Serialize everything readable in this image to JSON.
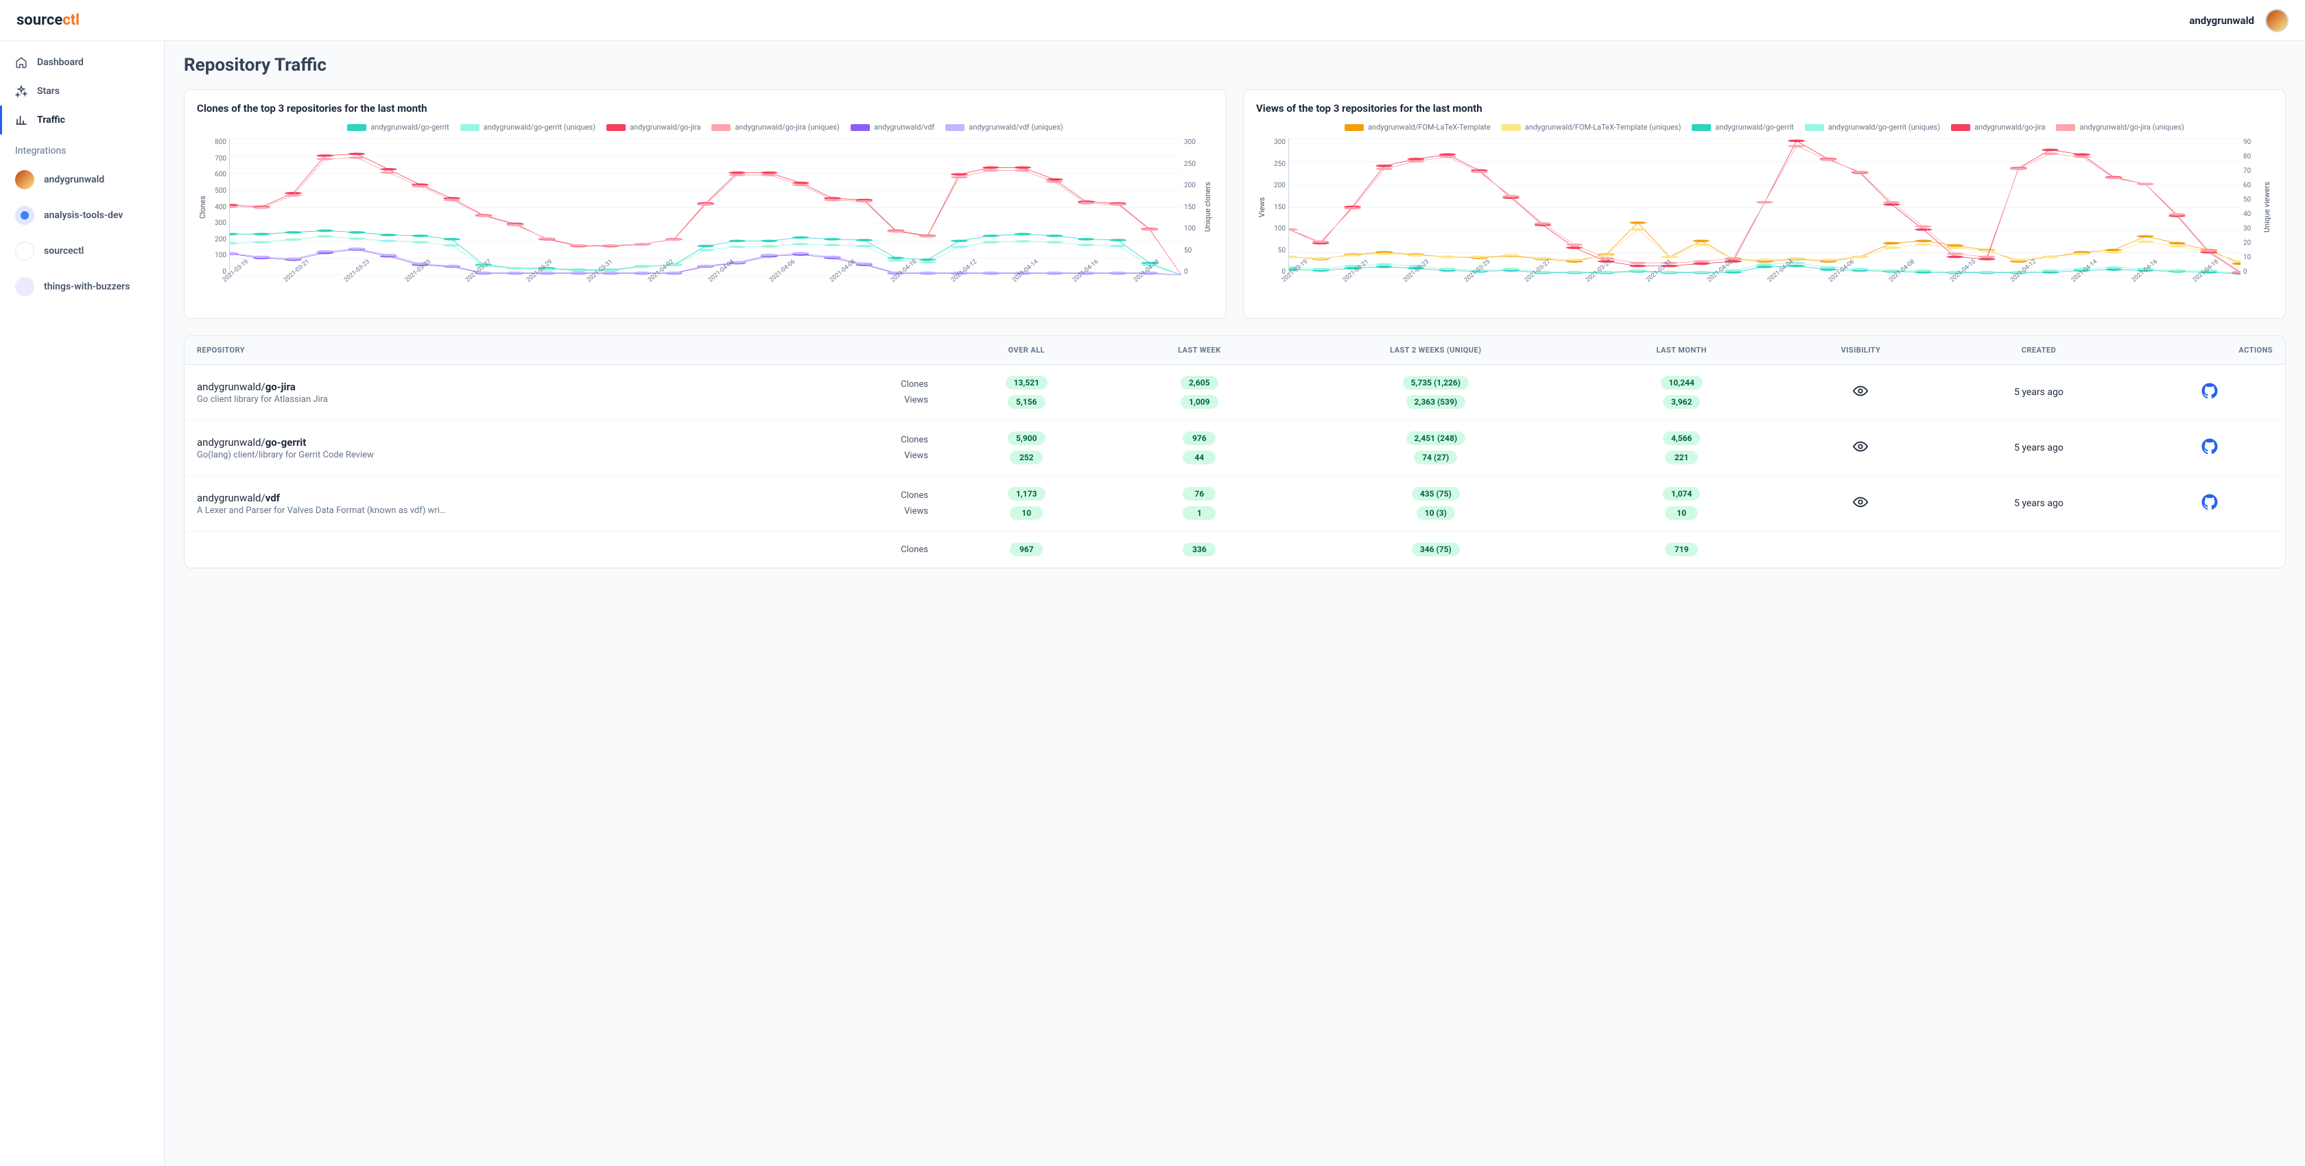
{
  "brand": {
    "p1": "source",
    "p2": "ctl"
  },
  "user": {
    "name": "andygrunwald"
  },
  "nav": [
    {
      "icon": "home",
      "label": "Dashboard",
      "active": false
    },
    {
      "icon": "sparkle",
      "label": "Stars",
      "active": false
    },
    {
      "icon": "chart",
      "label": "Traffic",
      "active": true
    }
  ],
  "sidebar_section": "Integrations",
  "integrations": [
    {
      "kind": "user",
      "label": "andygrunwald"
    },
    {
      "kind": "gear",
      "label": "analysis-tools-dev"
    },
    {
      "kind": "source",
      "label": "sourcectl"
    },
    {
      "kind": "buzz",
      "label": "things-with-buzzers"
    }
  ],
  "page_title": "Repository Traffic",
  "clones_chart_title": "Clones of the top 3 repositories for the last month",
  "views_chart_title": "Views of the top 3 repositories for the last month",
  "table": {
    "headers": {
      "repo": "REPOSITORY",
      "overall": "OVER ALL",
      "lastweek": "LAST WEEK",
      "last2": "LAST 2 WEEKS (UNIQUE)",
      "lastmonth": "LAST MONTH",
      "visibility": "VISIBILITY",
      "created": "CREATED",
      "actions": "ACTIONS"
    },
    "row_labels": {
      "clones": "Clones",
      "views": "Views"
    },
    "rows": [
      {
        "owner": "andygrunwald/",
        "name": "go-jira",
        "desc": "Go client library for Atlassian Jira",
        "clones": {
          "overall": "13,521",
          "lastweek": "2,605",
          "last2": "5,735 (1,226)",
          "lastmonth": "10,244"
        },
        "views": {
          "overall": "5,156",
          "lastweek": "1,009",
          "last2": "2,363 (539)",
          "lastmonth": "3,962"
        },
        "created": "5 years ago"
      },
      {
        "owner": "andygrunwald/",
        "name": "go-gerrit",
        "desc": "Go(lang) client/library for Gerrit Code Review",
        "clones": {
          "overall": "5,900",
          "lastweek": "976",
          "last2": "2,451 (248)",
          "lastmonth": "4,566"
        },
        "views": {
          "overall": "252",
          "lastweek": "44",
          "last2": "74 (27)",
          "lastmonth": "221"
        },
        "created": "5 years ago"
      },
      {
        "owner": "andygrunwald/",
        "name": "vdf",
        "desc": "A Lexer and Parser for Valves Data Format (known as vdf) wri…",
        "clones": {
          "overall": "1,173",
          "lastweek": "76",
          "last2": "435 (75)",
          "lastmonth": "1,074"
        },
        "views": {
          "overall": "10",
          "lastweek": "1",
          "last2": "10 (3)",
          "lastmonth": "10"
        },
        "created": "5 years ago"
      },
      {
        "owner": "",
        "name": "",
        "desc": "",
        "clones": {
          "overall": "967",
          "lastweek": "336",
          "last2": "346 (75)",
          "lastmonth": "719"
        },
        "views": {
          "overall": "",
          "lastweek": "",
          "last2": "",
          "lastmonth": ""
        },
        "created": ""
      }
    ]
  },
  "chart_data": [
    {
      "id": "clones",
      "type": "line",
      "xlabel": "",
      "ylabel": "Clones",
      "y2label": "Unique cloners",
      "ylim": [
        0,
        800
      ],
      "y2lim": [
        0,
        300
      ],
      "yticks": [
        0,
        100,
        200,
        300,
        400,
        500,
        600,
        700,
        800
      ],
      "y2ticks": [
        0,
        50,
        100,
        150,
        200,
        250,
        300
      ],
      "categories": [
        "2021-03-19",
        "2021-03-21",
        "2021-03-23",
        "2021-03-25",
        "2021-03-27",
        "2021-03-29",
        "2021-03-31",
        "2021-04-02",
        "2021-04-04",
        "2021-04-06",
        "2021-04-08",
        "2021-04-10",
        "2021-04-12",
        "2021-04-14",
        "2021-04-16",
        "2021-04-18"
      ],
      "x": [
        0,
        1,
        2,
        3,
        4,
        5,
        6,
        7,
        8,
        9,
        10,
        11,
        12,
        13,
        14,
        15,
        16,
        17,
        18,
        19,
        20,
        21,
        22,
        23,
        24,
        25,
        26,
        27,
        28,
        29,
        30
      ],
      "series": [
        {
          "name": "andygrunwald/go-gerrit",
          "color": "#2dd4bf",
          "axis": "y",
          "values": [
            240,
            240,
            250,
            260,
            250,
            235,
            230,
            210,
            60,
            40,
            40,
            30,
            30,
            50,
            60,
            170,
            200,
            200,
            220,
            210,
            205,
            100,
            90,
            200,
            230,
            240,
            230,
            210,
            205,
            70,
            0
          ]
        },
        {
          "name": "andygrunwald/go-gerrit (uniques)",
          "color": "#99f6e4",
          "axis": "y2",
          "values": [
            70,
            72,
            78,
            85,
            80,
            75,
            72,
            65,
            20,
            15,
            12,
            10,
            10,
            18,
            22,
            55,
            62,
            63,
            68,
            66,
            64,
            32,
            28,
            62,
            72,
            74,
            72,
            66,
            64,
            22,
            0
          ]
        },
        {
          "name": "andygrunwald/go-jira",
          "color": "#f43f5e",
          "axis": "y",
          "values": [
            410,
            400,
            480,
            700,
            710,
            620,
            530,
            450,
            350,
            300,
            210,
            170,
            170,
            180,
            210,
            420,
            600,
            600,
            540,
            450,
            440,
            260,
            230,
            590,
            630,
            630,
            560,
            430,
            420,
            270,
            0
          ]
        },
        {
          "name": "andygrunwald/go-jira (uniques)",
          "color": "#fda4af",
          "axis": "y2",
          "values": [
            150,
            148,
            175,
            255,
            258,
            225,
            195,
            165,
            130,
            110,
            80,
            65,
            65,
            68,
            78,
            155,
            220,
            220,
            198,
            165,
            162,
            96,
            85,
            215,
            230,
            230,
            205,
            158,
            155,
            100,
            0
          ]
        },
        {
          "name": "andygrunwald/vdf",
          "color": "#8b5cf6",
          "axis": "y",
          "values": [
            125,
            100,
            90,
            130,
            150,
            110,
            60,
            50,
            10,
            10,
            10,
            10,
            10,
            10,
            10,
            50,
            70,
            110,
            120,
            100,
            60,
            10,
            10,
            10,
            10,
            10,
            10,
            10,
            10,
            10,
            0
          ]
        },
        {
          "name": "andygrunwald/vdf (uniques)",
          "color": "#c4b5fd",
          "axis": "y2",
          "values": [
            48,
            40,
            36,
            52,
            58,
            44,
            25,
            20,
            5,
            5,
            5,
            5,
            5,
            5,
            5,
            20,
            28,
            44,
            48,
            40,
            25,
            5,
            5,
            5,
            5,
            5,
            5,
            5,
            5,
            5,
            0
          ]
        }
      ]
    },
    {
      "id": "views",
      "type": "line",
      "xlabel": "",
      "ylabel": "Views",
      "y2label": "Unique viewers",
      "ylim": [
        0,
        300
      ],
      "y2lim": [
        0,
        90
      ],
      "yticks": [
        0,
        50,
        100,
        150,
        200,
        250,
        300
      ],
      "y2ticks": [
        0,
        10,
        20,
        30,
        40,
        50,
        60,
        70,
        80,
        90
      ],
      "categories": [
        "2021-03-19",
        "2021-03-21",
        "2021-03-23",
        "2021-03-25",
        "2021-03-27",
        "2021-03-29",
        "2021-03-31",
        "2021-04-02",
        "2021-04-04",
        "2021-04-06",
        "2021-04-08",
        "2021-04-10",
        "2021-04-12",
        "2021-04-14",
        "2021-04-16",
        "2021-04-18"
      ],
      "x": [
        0,
        1,
        2,
        3,
        4,
        5,
        6,
        7,
        8,
        9,
        10,
        11,
        12,
        13,
        14,
        15,
        16,
        17,
        18,
        19,
        20,
        21,
        22,
        23,
        24,
        25,
        26,
        27,
        28,
        29,
        30
      ],
      "series": [
        {
          "name": "andygrunwald/FOM-LaTeX-Template",
          "color": "#f59e0b",
          "axis": "y",
          "values": [
            40,
            35,
            45,
            50,
            45,
            40,
            38,
            42,
            35,
            30,
            45,
            115,
            40,
            75,
            35,
            30,
            35,
            30,
            40,
            70,
            75,
            65,
            55,
            30,
            40,
            50,
            55,
            85,
            70,
            55,
            25
          ]
        },
        {
          "name": "andygrunwald/FOM-LaTeX-Template (uniques)",
          "color": "#fde68a",
          "axis": "y2",
          "values": [
            12,
            11,
            13,
            14,
            13,
            12,
            12,
            13,
            11,
            10,
            13,
            30,
            12,
            20,
            11,
            10,
            11,
            10,
            12,
            18,
            20,
            18,
            16,
            10,
            12,
            14,
            15,
            22,
            19,
            15,
            9
          ]
        },
        {
          "name": "andygrunwald/go-gerrit",
          "color": "#2dd4bf",
          "axis": "y",
          "values": [
            12,
            10,
            15,
            18,
            15,
            10,
            8,
            10,
            5,
            5,
            5,
            8,
            5,
            5,
            6,
            18,
            20,
            12,
            10,
            8,
            6,
            5,
            5,
            5,
            6,
            10,
            12,
            10,
            8,
            6,
            3
          ]
        },
        {
          "name": "andygrunwald/go-gerrit (uniques)",
          "color": "#99f6e4",
          "axis": "y2",
          "values": [
            5,
            4,
            6,
            7,
            6,
            4,
            3,
            4,
            2,
            2,
            2,
            3,
            2,
            2,
            3,
            7,
            8,
            5,
            4,
            3,
            3,
            2,
            2,
            2,
            3,
            4,
            5,
            4,
            3,
            3,
            1
          ]
        },
        {
          "name": "andygrunwald/go-jira",
          "color": "#f43f5e",
          "axis": "y",
          "values": [
            100,
            70,
            150,
            240,
            255,
            265,
            230,
            170,
            110,
            60,
            30,
            20,
            20,
            25,
            30,
            160,
            295,
            255,
            225,
            155,
            100,
            40,
            35,
            235,
            275,
            265,
            215,
            200,
            130,
            50,
            5
          ]
        },
        {
          "name": "andygrunwald/go-jira (uniques)",
          "color": "#fda4af",
          "axis": "y2",
          "values": [
            30,
            22,
            44,
            70,
            75,
            78,
            68,
            52,
            34,
            20,
            11,
            8,
            8,
            9,
            11,
            48,
            85,
            76,
            68,
            48,
            32,
            14,
            12,
            70,
            80,
            78,
            64,
            60,
            40,
            16,
            2
          ]
        }
      ]
    }
  ]
}
